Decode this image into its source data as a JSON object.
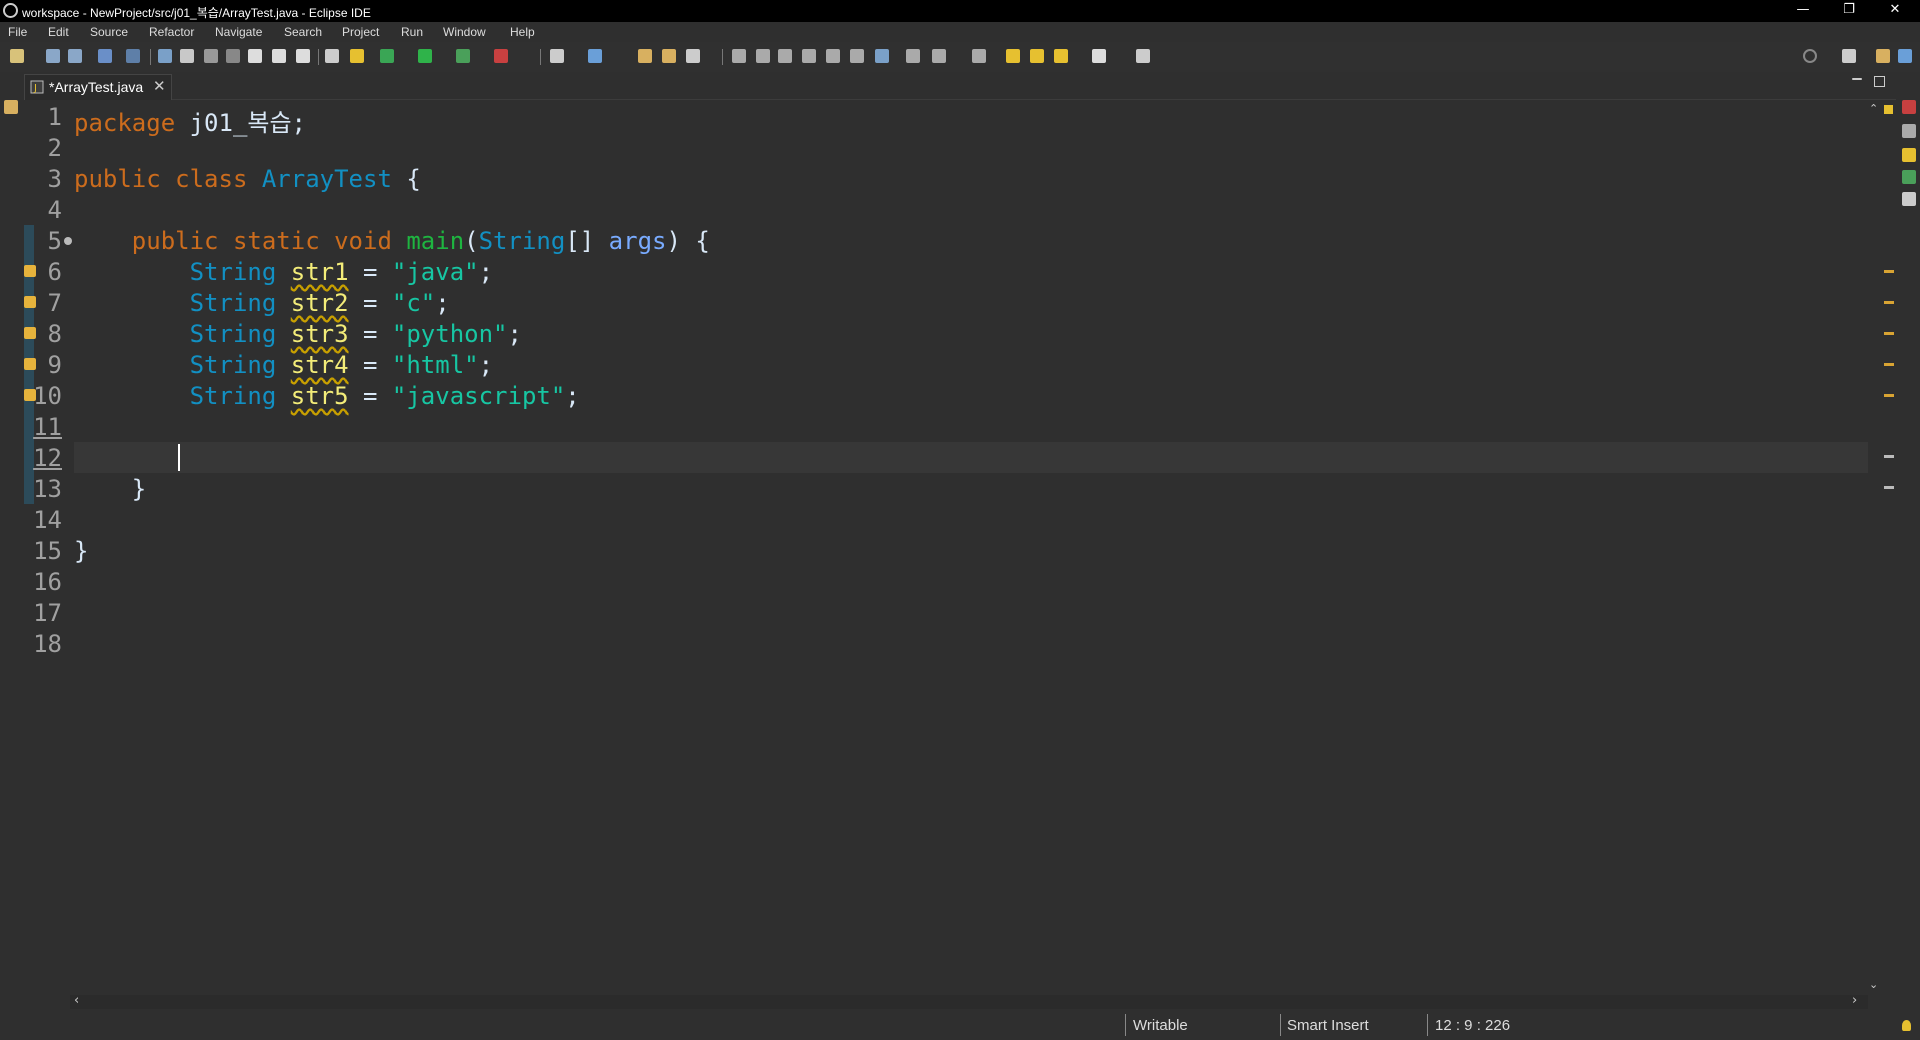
{
  "window": {
    "title": "workspace - NewProject/src/j01_복습/ArrayTest.java - Eclipse IDE",
    "minimize": "—",
    "restore": "❐",
    "close": "✕"
  },
  "menu": [
    "File",
    "Edit",
    "Source",
    "Refactor",
    "Navigate",
    "Search",
    "Project",
    "Run",
    "Window",
    "Help"
  ],
  "editor_tab": {
    "label": "*ArrayTest.java",
    "close": "✕"
  },
  "code": {
    "line_numbers": [
      "1",
      "2",
      "3",
      "4",
      "5",
      "6",
      "7",
      "8",
      "9",
      "10",
      "11",
      "12",
      "13",
      "14",
      "15",
      "16",
      "17",
      "18"
    ],
    "line1": {
      "kw": "package",
      "rest": " j01_복습;"
    },
    "line3": {
      "kw1": "public",
      "kw2": "class",
      "cls": "ArrayTest",
      "rest": " {"
    },
    "line5": {
      "kw1": "public",
      "kw2": "static",
      "kw3": "void",
      "fn": "main",
      "open": "(",
      "type": "String",
      "arr": "[] ",
      "param": "args",
      "close": ") {"
    },
    "vars": [
      {
        "type": "String",
        "name": "str1",
        "eq": " = ",
        "value": "\"java\"",
        "end": ";"
      },
      {
        "type": "String",
        "name": "str2",
        "eq": " = ",
        "value": "\"c\"",
        "end": ";"
      },
      {
        "type": "String",
        "name": "str3",
        "eq": " = ",
        "value": "\"python\"",
        "end": ";"
      },
      {
        "type": "String",
        "name": "str4",
        "eq": " = ",
        "value": "\"html\"",
        "end": ";"
      },
      {
        "type": "String",
        "name": "str5",
        "eq": " = ",
        "value": "\"javascript\"",
        "end": ";"
      }
    ],
    "line13": "}",
    "line15": "}"
  },
  "status": {
    "writable": "Writable",
    "insert_mode": "Smart Insert",
    "position": "12 : 9 : 226"
  },
  "colors": {
    "keyword": "#cc6c1d",
    "type": "#1290c3",
    "method": "#1eb540",
    "string": "#17c6a3",
    "field": "#f3ec79",
    "background": "#2f2f2f"
  }
}
